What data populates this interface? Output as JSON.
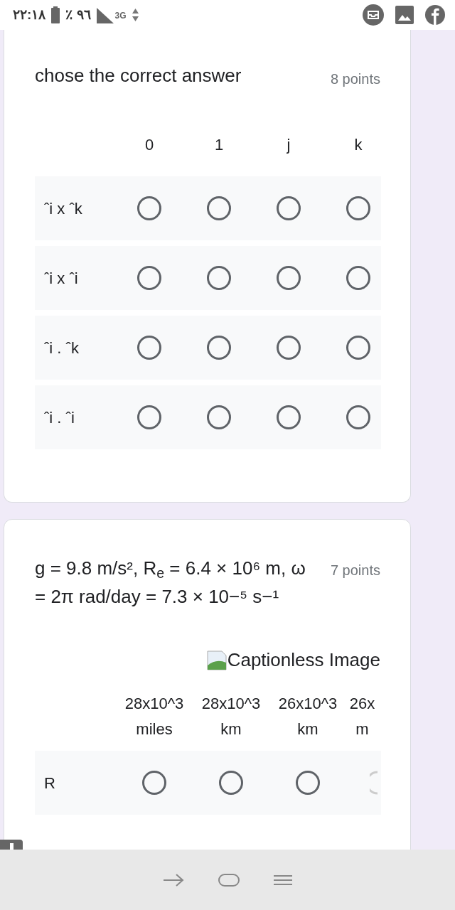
{
  "status_bar": {
    "time": "٢٢:١٨",
    "battery": "٪ ٩٦",
    "network": "3G"
  },
  "questions": [
    {
      "title": "chose the correct answer",
      "points": "8 points",
      "columns": [
        "0",
        "1",
        "j",
        "k"
      ],
      "rows": [
        {
          "label": "ˆi x ˆk",
          "choices": [
            {
              "selected": false
            },
            {
              "selected": false
            },
            {
              "selected": false
            },
            {
              "selected": false
            }
          ]
        },
        {
          "label": "ˆi x ˆi",
          "choices": [
            {
              "selected": false
            },
            {
              "selected": false
            },
            {
              "selected": false
            },
            {
              "selected": false
            }
          ]
        },
        {
          "label": "ˆi . ˆk",
          "choices": [
            {
              "selected": false
            },
            {
              "selected": false
            },
            {
              "selected": false
            },
            {
              "selected": false
            }
          ]
        },
        {
          "label": "ˆi . ˆi",
          "choices": [
            {
              "selected": false
            },
            {
              "selected": false
            },
            {
              "selected": false
            },
            {
              "selected": false
            }
          ]
        }
      ]
    },
    {
      "title": "g = 9.8 m/s², R$_{e}$ = 6.4 × 10⁶ m, ω = 2π rad/day = 7.3 × 10−⁵ s−¹",
      "points": "7 points",
      "image": {
        "caption": "Captionless Image"
      },
      "columns": [
        "28x10^3 miles",
        "28x10^3 km",
        "26x10^3 km",
        "26x m"
      ],
      "rows": [
        {
          "label": "R",
          "choices": [
            {
              "selected": false
            },
            {
              "selected": false
            },
            {
              "selected": false
            },
            {
              "selected": false
            }
          ]
        }
      ]
    }
  ]
}
